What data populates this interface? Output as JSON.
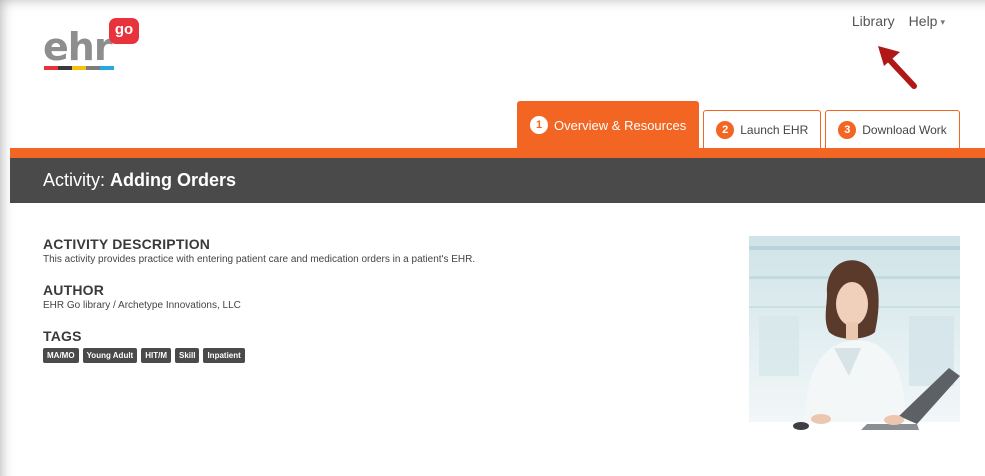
{
  "logo": {
    "text": "ehr",
    "badge": "go",
    "bar_colors": [
      "#e8333c",
      "#3a3a3a",
      "#f4c20d",
      "#7d7d7d",
      "#29a8e0",
      "#8e8e8e"
    ]
  },
  "top_nav": {
    "library": "Library",
    "help": "Help",
    "help_caret": "▾"
  },
  "tabs": [
    {
      "num": "1",
      "label": "Overview & Resources",
      "active": true
    },
    {
      "num": "2",
      "label": "Launch EHR"
    },
    {
      "num": "3",
      "label": "Download Work"
    }
  ],
  "activity": {
    "prefix": "Activity:",
    "name": "Adding Orders"
  },
  "description": {
    "heading": "ACTIVITY DESCRIPTION",
    "text": "This activity provides practice with entering patient care and medication orders in a patient's EHR."
  },
  "author": {
    "heading": "AUTHOR",
    "text": "EHR Go library / Archetype Innovations, LLC"
  },
  "tags": {
    "heading": "TAGS",
    "items": [
      "MA/MO",
      "Young Adult",
      "HIT/M",
      "Skill",
      "Inpatient"
    ]
  },
  "colors": {
    "accent": "#f26522",
    "dark_bar": "#4a4a4a",
    "annotation_arrow": "#b01818"
  }
}
